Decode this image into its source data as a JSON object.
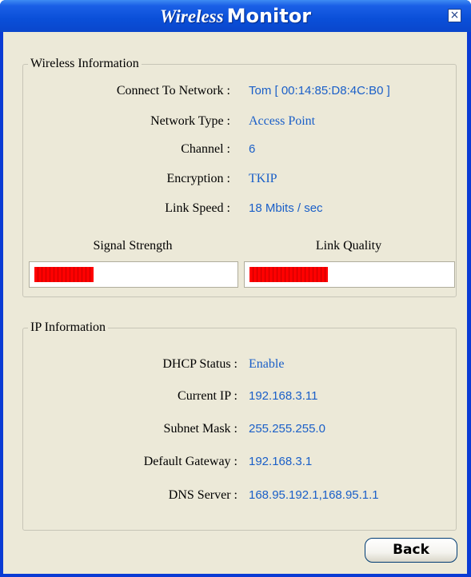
{
  "window": {
    "title_part1": "Wireless",
    "title_part2": "Monitor",
    "close_label": "×"
  },
  "wireless_info": {
    "group_title": "Wireless Information",
    "rows": [
      {
        "label": "Connect To Network :",
        "value": "Tom [ 00:14:85:D8:4C:B0 ]"
      },
      {
        "label": "Network Type :",
        "value": "Access Point"
      },
      {
        "label": "Channel :",
        "value": "6"
      },
      {
        "label": "Encryption :",
        "value": "TKIP"
      },
      {
        "label": "Link Speed :",
        "value": "18 Mbits / sec"
      }
    ],
    "signal_strength": {
      "label": "Signal Strength",
      "level": 0.3
    },
    "link_quality": {
      "label": "Link Quality",
      "level": 0.39
    }
  },
  "ip_info": {
    "group_title": "IP Information",
    "rows": [
      {
        "label": "DHCP Status :",
        "value": "Enable"
      },
      {
        "label": "Current IP :",
        "value": "192.168.3.11"
      },
      {
        "label": "Subnet Mask :",
        "value": "255.255.255.0"
      },
      {
        "label": "Default Gateway :",
        "value": "192.168.3.1"
      },
      {
        "label": "DNS Server :",
        "value": "168.95.192.1,168.95.1.1"
      }
    ]
  },
  "buttons": {
    "back_label": "Back"
  },
  "colors": {
    "titlebar": "#0a4fd8",
    "value_text": "#1a5fc8",
    "meter_fill": "#ff0000",
    "dialog_bg": "#ece9d8"
  }
}
